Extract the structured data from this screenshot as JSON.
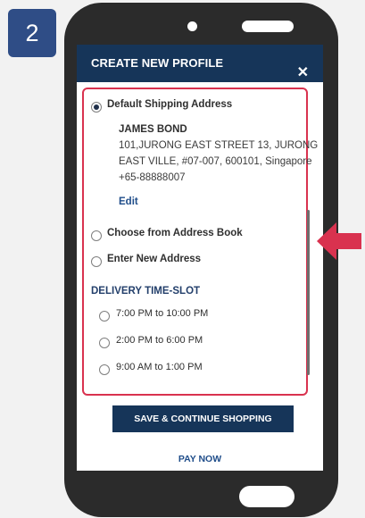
{
  "step_badge": "2",
  "header": {
    "title": "CREATE NEW PROFILE",
    "close_icon": "✕"
  },
  "shipping": {
    "default_label": "Default Shipping Address",
    "name": "JAMES BOND",
    "address_lines": [
      "101,JURONG EAST STREET 13, JURONG",
      "EAST VILLE, #07-007, 600101, Singapore",
      "+65-88888007"
    ],
    "edit_label": "Edit",
    "choose_book_label": "Choose from Address Book",
    "new_address_label": "Enter New Address",
    "selected_option": "Default Shipping Address"
  },
  "delivery": {
    "title": "DELIVERY TIME-SLOT",
    "slots": [
      "7:00 PM to 10:00 PM",
      "2:00 PM to 6:00 PM",
      "9:00 AM to 1:00 PM"
    ]
  },
  "actions": {
    "save_label": "SAVE & CONTINUE SHOPPING",
    "pay_label": "PAY NOW"
  },
  "colors": {
    "brand": "#163559",
    "accent": "#d9324f",
    "step_badge": "#2f4d86"
  }
}
